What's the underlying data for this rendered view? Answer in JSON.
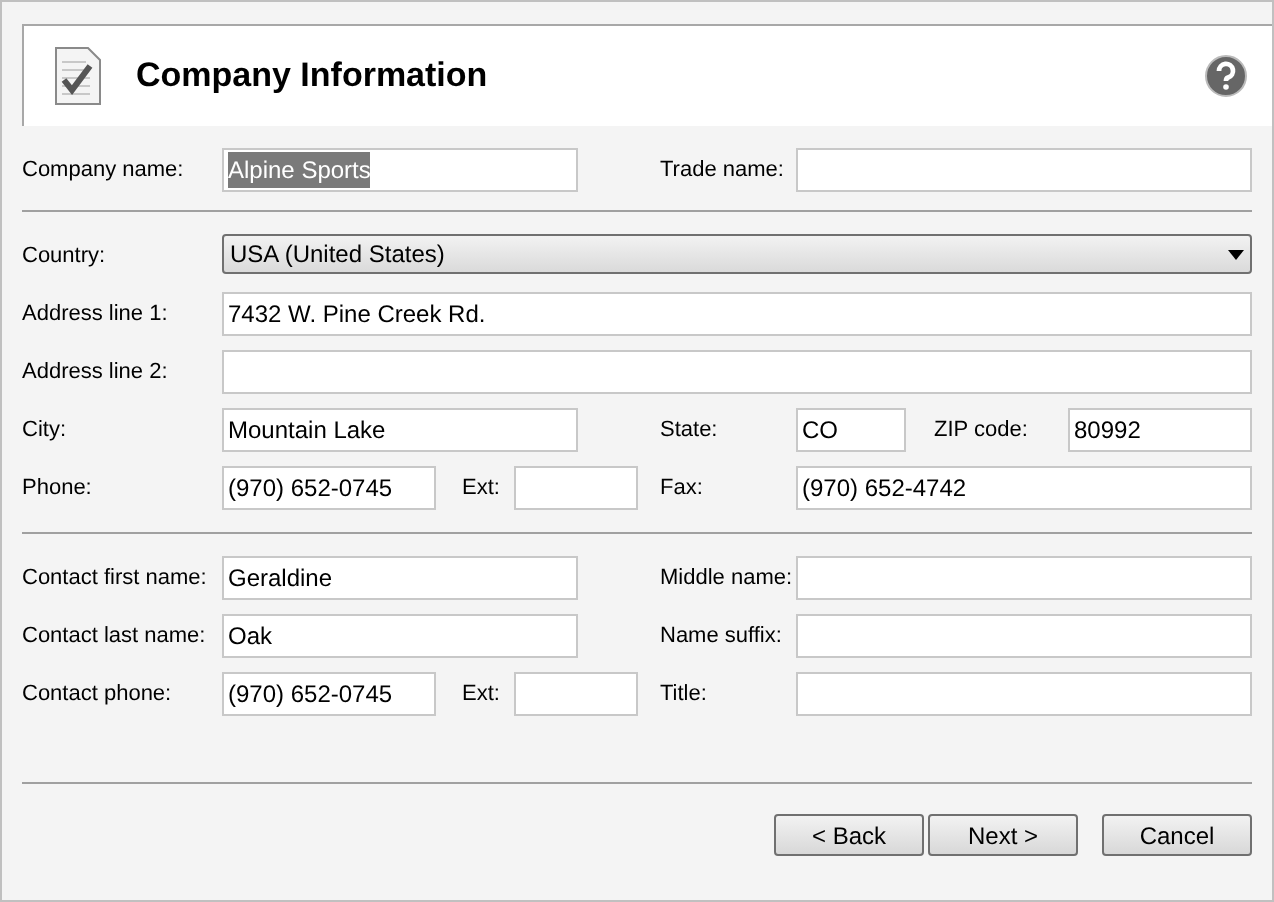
{
  "header": {
    "title": "Company Information"
  },
  "sections": [
    {
      "rows": [
        {
          "fields": [
            {
              "label": "Company name:",
              "kind": "text",
              "value": "Alpine Sports",
              "highlighted": true
            },
            {
              "label": "Trade name:",
              "kind": "text"
            }
          ]
        }
      ]
    },
    {
      "rows": [
        {
          "fields": [
            {
              "label": "Country:",
              "kind": "dropdown",
              "value": "USA (United States)"
            }
          ]
        },
        {
          "fields": [
            {
              "label": "Address line 1:",
              "kind": "text",
              "value": "7432 W. Pine Creek Rd."
            }
          ]
        },
        {
          "fields": [
            {
              "label": "Address line 2:",
              "kind": "text"
            }
          ]
        },
        {
          "fields": [
            {
              "label": "City:",
              "kind": "text",
              "value": "Mountain Lake"
            },
            {
              "label": "State:",
              "kind": "text",
              "value": "CO"
            },
            {
              "label": "ZIP code:",
              "kind": "text",
              "value": "80992"
            }
          ]
        },
        {
          "fields": [
            {
              "label": "Phone:",
              "kind": "text",
              "value": "(970) 652-0745"
            },
            {
              "label": "Ext:",
              "kind": "text"
            },
            {
              "label": "Fax:",
              "kind": "text",
              "value": "(970) 652-4742"
            }
          ]
        }
      ]
    },
    {
      "rows": [
        {
          "fields": [
            {
              "label": "Contact first name:",
              "kind": "text",
              "value": "Geraldine"
            },
            {
              "label": "Middle name:",
              "kind": "text"
            }
          ]
        },
        {
          "fields": [
            {
              "label": "Contact last name:",
              "kind": "text",
              "value": "Oak"
            },
            {
              "label": "Name suffix:",
              "kind": "text"
            }
          ]
        },
        {
          "fields": [
            {
              "label": "Contact phone:",
              "kind": "text",
              "value": "(970) 652-0745"
            },
            {
              "label": "Ext:",
              "kind": "text"
            },
            {
              "label": "Title:",
              "kind": "text"
            }
          ]
        }
      ]
    }
  ],
  "buttons": [
    "< Back",
    "Next >",
    "Cancel"
  ]
}
